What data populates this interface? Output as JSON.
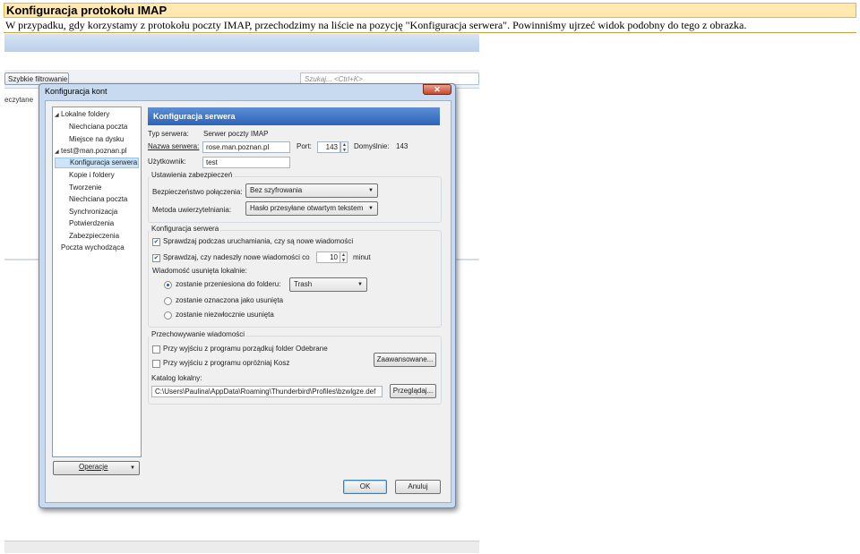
{
  "header": {
    "title": "Konfiguracja protokołu IMAP",
    "description": "W przypadku, gdy korzystamy z protokołu poczty IMAP, przechodzimy na liście na pozycję \"Konfiguracja serwera\". Powinniśmy ujrzeć widok podobny do tego z obrazka."
  },
  "background": {
    "filter_button": "Szybkie filtrowanie",
    "search_placeholder": "Szukaj... <Ctrl+K>",
    "column_label": "eczytane"
  },
  "dialog": {
    "title": "Konfiguracja kont",
    "close_symbol": "✕",
    "tree": [
      {
        "label": "Lokalne foldery",
        "toggle": "◢"
      },
      {
        "label": "Niechciana poczta",
        "toggle": ""
      },
      {
        "label": "Miejsce na dysku",
        "toggle": ""
      },
      {
        "label": "test@man.poznan.pl",
        "toggle": "◢"
      },
      {
        "label": "Konfiguracja serwera",
        "toggle": ""
      },
      {
        "label": "Kopie i foldery",
        "toggle": ""
      },
      {
        "label": "Tworzenie",
        "toggle": ""
      },
      {
        "label": "Niechciana poczta",
        "toggle": ""
      },
      {
        "label": "Synchronizacja",
        "toggle": ""
      },
      {
        "label": "Potwierdzenia",
        "toggle": ""
      },
      {
        "label": "Zabezpieczenia",
        "toggle": ""
      },
      {
        "label": "Poczta wychodząca",
        "toggle": ""
      }
    ],
    "selected_tree_item": "Konfiguracja serwera",
    "operations_button": "Operacje",
    "page_title": "Konfiguracja serwera",
    "server_type_label": "Typ serwera:",
    "server_type_value": "Serwer poczty IMAP",
    "server_name_label": "Nazwa serwera:",
    "server_name_value": "rose.man.poznan.pl",
    "port_label": "Port:",
    "port_value": "143",
    "default_label": "Domyślnie:",
    "default_value": "143",
    "username_label": "Użytkownik:",
    "username_value": "test",
    "security": {
      "title": "Ustawienia zabezpieczeń",
      "connection_label": "Bezpieczeństwo połączenia:",
      "connection_value": "Bez szyfrowania",
      "auth_label": "Metoda uwierzytelniania:",
      "auth_value": "Hasło przesyłane otwartym tekstem"
    },
    "server_settings": {
      "title": "Konfiguracja serwera",
      "check_startup": "Sprawdzaj podczas uruchamiania, czy są nowe wiadomości",
      "check_startup_checked": true,
      "check_interval": "Sprawdzaj, czy nadeszły nowe wiadomości co",
      "check_interval_checked": true,
      "interval_value": "10",
      "interval_unit": "minut",
      "deleted_label": "Wiadomość usunięta lokalnie:",
      "radio_move": "zostanie przeniesiona do folderu:",
      "trash_folder": "Trash",
      "radio_mark": "zostanie oznaczona jako usunięta",
      "radio_delete": "zostanie niezwłocznie usunięta",
      "selected_radio": "move"
    },
    "storage": {
      "title": "Przechowywanie wiadomości",
      "cleanup_inbox": "Przy wyjściu z programu porządkuj folder Odebrane",
      "empty_trash": "Przy wyjściu z programu opróżniaj Kosz",
      "advanced_button": "Zaawansowane...",
      "local_dir_label": "Katalog lokalny:",
      "local_dir_value": "C:\\Users\\Paulina\\AppData\\Roaming\\Thunderbird\\Profiles\\bzwlgze.def",
      "browse_button": "Przeglądaj..."
    },
    "ok_button": "OK",
    "cancel_button": "Anuluj",
    "check_mark": "✔",
    "dropdown_arrow": "▼",
    "spin_up": "▲",
    "spin_down": "▼"
  },
  "colors": {
    "header_bg": "#ffe9b0",
    "page_title_bg": "#2c63b8",
    "selection": "#cde3f8"
  }
}
